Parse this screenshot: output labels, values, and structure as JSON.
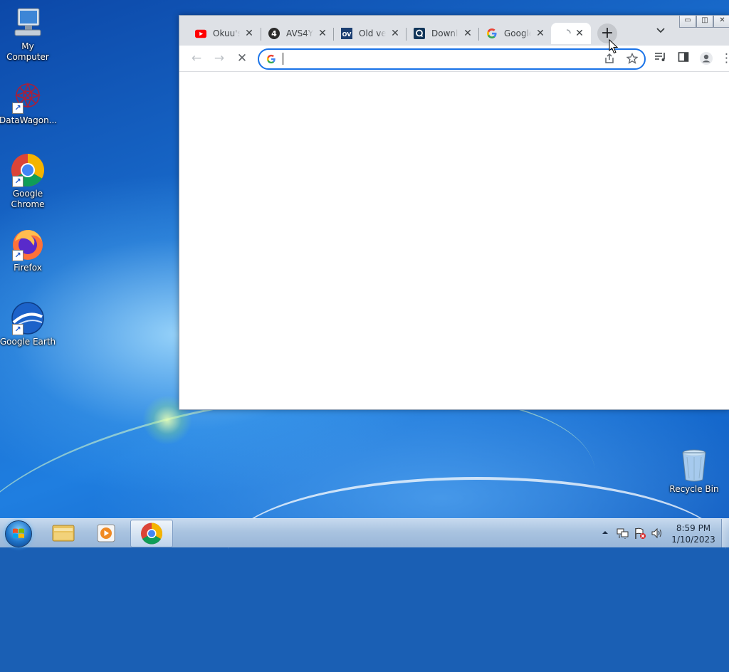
{
  "desktop": {
    "icons": [
      {
        "label": "My Computer",
        "icon": "computer-icon"
      },
      {
        "label": "DataWagon...",
        "icon": "datawagon-icon"
      },
      {
        "label": "Google Chrome",
        "icon": "chrome-icon"
      },
      {
        "label": "Firefox",
        "icon": "firefox-icon"
      },
      {
        "label": "Google Earth",
        "icon": "google-earth-icon"
      },
      {
        "label": "Recycle Bin",
        "icon": "recycle-bin-icon"
      }
    ]
  },
  "browser": {
    "tabs": [
      {
        "title": "Okuu's",
        "favicon": "youtube-icon"
      },
      {
        "title": "AVS4YO",
        "favicon": "avs4you-icon"
      },
      {
        "title": "Old ver",
        "favicon": "oldversion-icon"
      },
      {
        "title": "Downlo",
        "favicon": "download-site-icon"
      },
      {
        "title": "Google",
        "favicon": "google-icon"
      },
      {
        "title": "",
        "favicon": "loading-icon",
        "active": true
      }
    ],
    "new_tab_symbol": "+",
    "omnibox": {
      "value": "",
      "placeholder": ""
    },
    "colors": {
      "focus": "#1a73e8",
      "tabstrip": "#dee1e6"
    }
  },
  "taskbar": {
    "clock": {
      "time": "8:59 PM",
      "date": "1/10/2023"
    },
    "pinned": [
      "file-explorer-icon",
      "media-player-icon",
      "chrome-icon"
    ]
  }
}
